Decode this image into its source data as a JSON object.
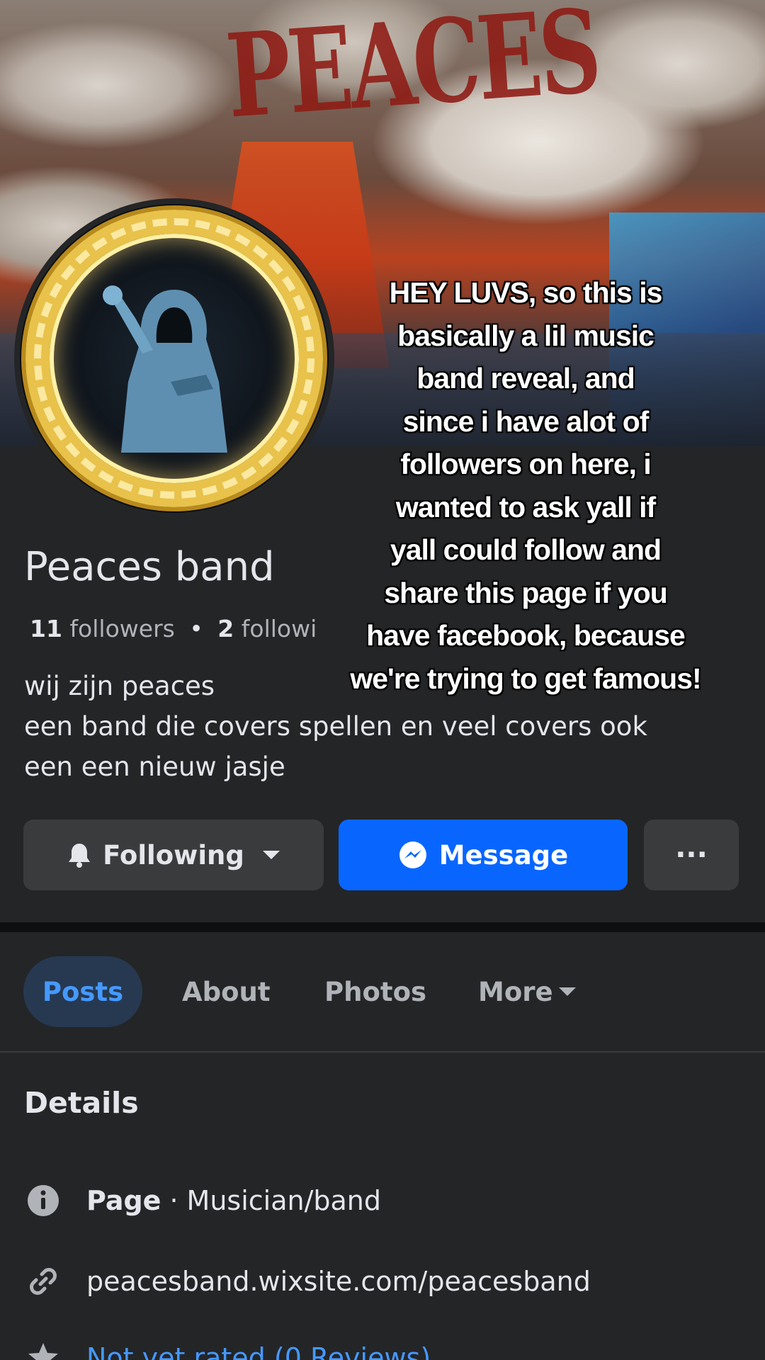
{
  "cover": {
    "title": "PEACES"
  },
  "profile": {
    "name": "Peaces band",
    "followers_count": "11",
    "followers_label": "followers",
    "separator": "•",
    "following_count": "2",
    "following_label": "followi",
    "bio_lines": [
      "wij zijn peaces",
      "een band die covers spellen en veel covers ook",
      "een een nieuw jasje"
    ]
  },
  "overlay_caption": {
    "lines": [
      "HEY LUVS, so this is",
      "basically a lil music",
      "band reveal, and",
      "since i have alot of",
      "followers on here, i",
      "wanted to ask yall if",
      "yall could follow and",
      "share this page if you",
      "have facebook, because",
      "we're trying to get famous!"
    ]
  },
  "actions": {
    "following_label": "Following",
    "message_label": "Message",
    "more_label": "···"
  },
  "tabs": [
    {
      "label": "Posts",
      "active": true
    },
    {
      "label": "About",
      "active": false
    },
    {
      "label": "Photos",
      "active": false
    },
    {
      "label": "More",
      "active": false
    }
  ],
  "details": {
    "title": "Details",
    "page_type_label": "Page",
    "page_type_sep": "·",
    "page_type_value": "Musician/band",
    "website": "peacesband.wixsite.com/peacesband",
    "rating_partial": "Not yet rated (0 Reviews)"
  },
  "colors": {
    "background": "#242527",
    "button_secondary": "#3a3b3c",
    "button_primary": "#0866ff",
    "tab_active_bg": "#263951",
    "tab_active_text": "#4599ff"
  },
  "icons": {
    "following": "bell-icon",
    "message": "messenger-icon",
    "details_page": "info-icon",
    "details_link": "link-icon",
    "details_rating": "star-icon"
  }
}
